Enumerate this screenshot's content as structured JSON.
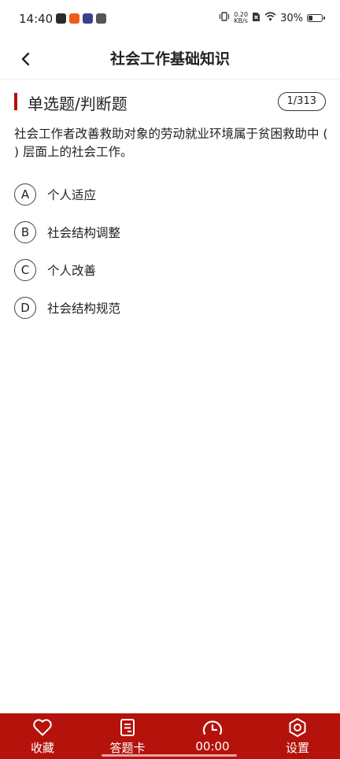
{
  "status_bar": {
    "time": "14:40",
    "net_speed_value": "0.20",
    "net_speed_unit": "KB/s",
    "battery_text": "30%",
    "battery_level": 0.3,
    "app_icon_colors": [
      "#2b2b2b",
      "#f05a1a",
      "#3b3f8f",
      "#555555"
    ]
  },
  "header": {
    "title": "社会工作基础知识",
    "back_icon": "chevron-left-icon"
  },
  "section": {
    "title": "单选题/判断题",
    "counter": "1/313",
    "accent_color": "#b5120c"
  },
  "question": {
    "text": "社会工作者改善救助对象的劳动就业环境属于贫困救助中 ( ) 层面上的社会工作。"
  },
  "options": [
    {
      "letter": "A",
      "label": "个人适应"
    },
    {
      "letter": "B",
      "label": "社会结构调整"
    },
    {
      "letter": "C",
      "label": "个人改善"
    },
    {
      "letter": "D",
      "label": "社会结构规范"
    }
  ],
  "bottom_bar": {
    "background": "#b5120c",
    "tabs": [
      {
        "icon": "heart-icon",
        "label": "收藏"
      },
      {
        "icon": "answer-sheet-icon",
        "label": "答题卡"
      },
      {
        "icon": "timer-icon",
        "label": "00:00"
      },
      {
        "icon": "settings-icon",
        "label": "设置"
      }
    ]
  }
}
